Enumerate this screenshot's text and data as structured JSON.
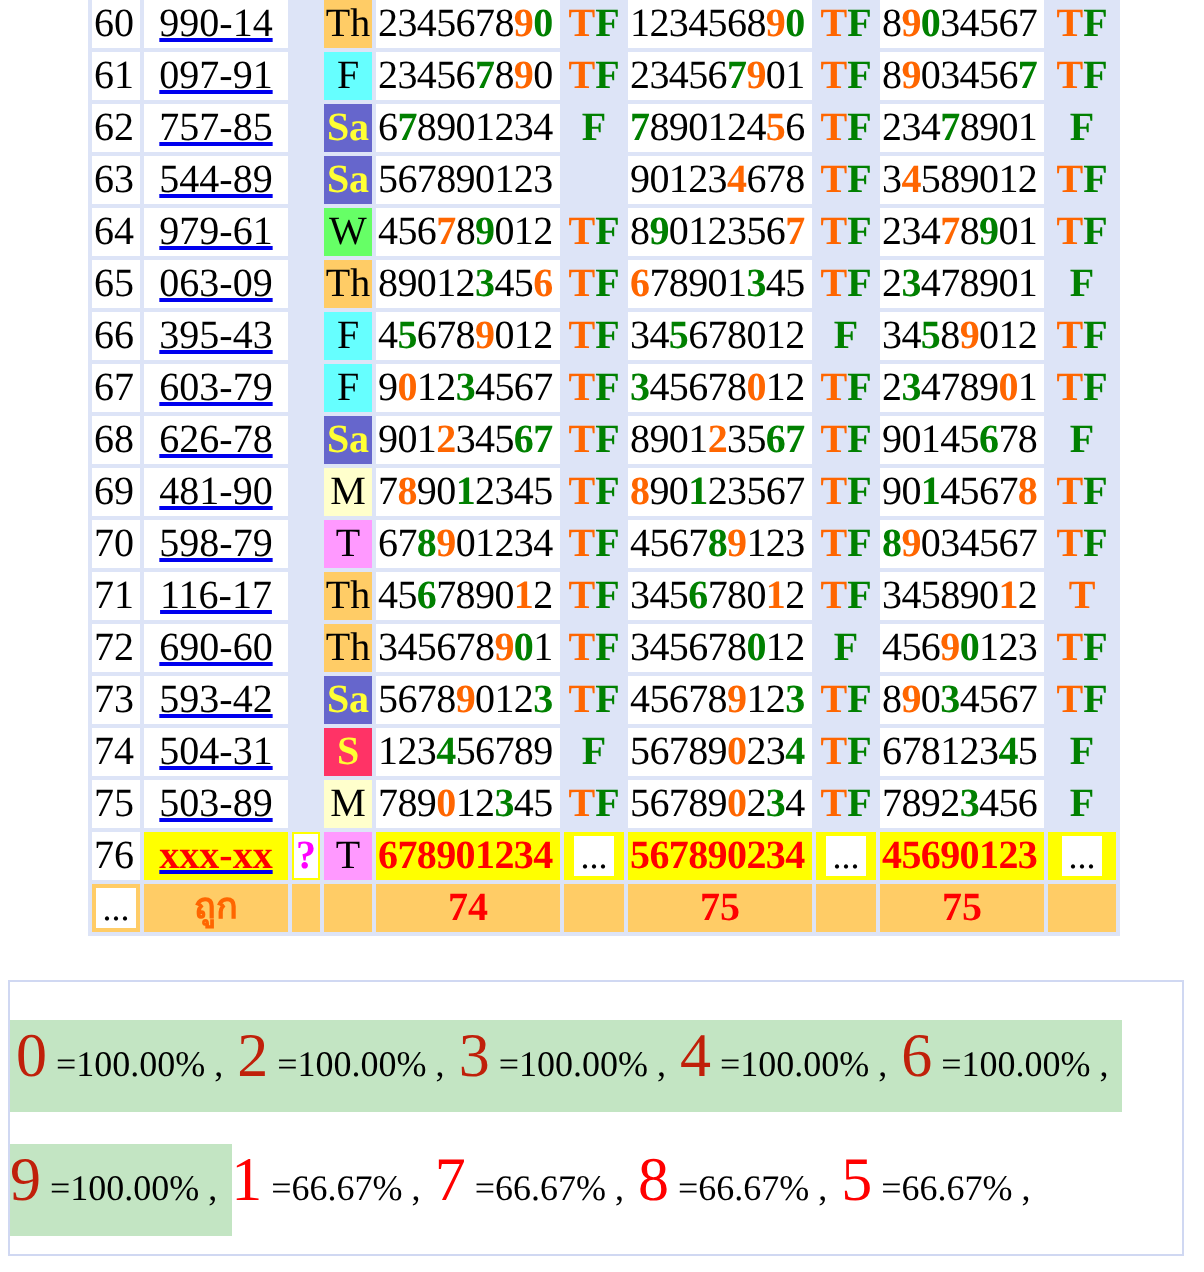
{
  "rows": [
    {
      "index": "60",
      "code": "990-14",
      "day": {
        "text": "Th",
        "color": "#ffcc66"
      },
      "numbers": [
        {
          "digits": [
            {
              "text": "2345678"
            },
            {
              "text": "9",
              "color": "#ff6600"
            },
            {
              "text": "0",
              "color": "#008000"
            }
          ],
          "result": [
            {
              "text": "T",
              "color": "#ff6600"
            },
            {
              "text": "F",
              "color": "#008000"
            }
          ]
        },
        {
          "digits": [
            {
              "text": "1234568"
            },
            {
              "text": "9",
              "color": "#ff6600"
            },
            {
              "text": "0",
              "color": "#008000"
            }
          ],
          "result": [
            {
              "text": "T",
              "color": "#ff6600"
            },
            {
              "text": "F",
              "color": "#008000"
            }
          ]
        },
        {
          "digits": [
            {
              "text": "8"
            },
            {
              "text": "9",
              "color": "#ff6600"
            },
            {
              "text": "0",
              "color": "#008000"
            },
            {
              "text": "34567"
            }
          ],
          "result": [
            {
              "text": "T",
              "color": "#ff6600"
            },
            {
              "text": "F",
              "color": "#008000"
            }
          ]
        }
      ]
    },
    {
      "index": "61",
      "code": "097-91",
      "day": {
        "text": "F",
        "color": "#66ffff"
      },
      "numbers": [
        {
          "digits": [
            {
              "text": "23456"
            },
            {
              "text": "7",
              "color": "#008000"
            },
            {
              "text": "8"
            },
            {
              "text": "9",
              "color": "#ff6600"
            },
            {
              "text": "0"
            }
          ],
          "result": [
            {
              "text": "T",
              "color": "#ff6600"
            },
            {
              "text": "F",
              "color": "#008000"
            }
          ]
        },
        {
          "digits": [
            {
              "text": "23456"
            },
            {
              "text": "7",
              "color": "#008000"
            },
            {
              "text": "9",
              "color": "#ff6600"
            },
            {
              "text": "01"
            }
          ],
          "result": [
            {
              "text": "T",
              "color": "#ff6600"
            },
            {
              "text": "F",
              "color": "#008000"
            }
          ]
        },
        {
          "digits": [
            {
              "text": "8"
            },
            {
              "text": "9",
              "color": "#ff6600"
            },
            {
              "text": "03456"
            },
            {
              "text": "7",
              "color": "#008000"
            }
          ],
          "result": [
            {
              "text": "T",
              "color": "#ff6600"
            },
            {
              "text": "F",
              "color": "#008000"
            }
          ]
        }
      ]
    },
    {
      "index": "62",
      "code": "757-85",
      "day": {
        "text": "Sa",
        "color": "#6666cc"
      },
      "numbers": [
        {
          "digits": [
            {
              "text": "6"
            },
            {
              "text": "7",
              "color": "#008000"
            },
            {
              "text": "8901234"
            }
          ],
          "result": [
            {
              "text": "F",
              "color": "#008000"
            }
          ]
        },
        {
          "digits": [
            {
              "text": "7",
              "color": "#008000"
            },
            {
              "text": "890124"
            },
            {
              "text": "5",
              "color": "#ff6600"
            },
            {
              "text": "6"
            }
          ],
          "result": [
            {
              "text": "T",
              "color": "#ff6600"
            },
            {
              "text": "F",
              "color": "#008000"
            }
          ]
        },
        {
          "digits": [
            {
              "text": "234"
            },
            {
              "text": "7",
              "color": "#008000"
            },
            {
              "text": "8901"
            }
          ],
          "result": [
            {
              "text": "F",
              "color": "#008000"
            }
          ]
        }
      ]
    },
    {
      "index": "63",
      "code": "544-89",
      "day": {
        "text": "Sa",
        "color": "#6666cc"
      },
      "numbers": [
        {
          "digits": [
            {
              "text": "567890123"
            }
          ]
        },
        {
          "digits": [
            {
              "text": "90123"
            },
            {
              "text": "4",
              "color": "#ff6600"
            },
            {
              "text": "678"
            }
          ],
          "result": [
            {
              "text": "T",
              "color": "#ff6600"
            },
            {
              "text": "F",
              "color": "#008000"
            }
          ]
        },
        {
          "digits": [
            {
              "text": "3"
            },
            {
              "text": "4",
              "color": "#ff6600"
            },
            {
              "text": "589012"
            }
          ],
          "result": [
            {
              "text": "T",
              "color": "#ff6600"
            },
            {
              "text": "F",
              "color": "#008000"
            }
          ]
        }
      ]
    },
    {
      "index": "64",
      "code": "979-61",
      "day": {
        "text": "W",
        "color": "#66ff66"
      },
      "numbers": [
        {
          "digits": [
            {
              "text": "456"
            },
            {
              "text": "7",
              "color": "#ff6600"
            },
            {
              "text": "8"
            },
            {
              "text": "9",
              "color": "#008000"
            },
            {
              "text": "012"
            }
          ],
          "result": [
            {
              "text": "T",
              "color": "#ff6600"
            },
            {
              "text": "F",
              "color": "#008000"
            }
          ]
        },
        {
          "digits": [
            {
              "text": "8"
            },
            {
              "text": "9",
              "color": "#008000"
            },
            {
              "text": "012356"
            },
            {
              "text": "7",
              "color": "#ff6600"
            }
          ],
          "result": [
            {
              "text": "T",
              "color": "#ff6600"
            },
            {
              "text": "F",
              "color": "#008000"
            }
          ]
        },
        {
          "digits": [
            {
              "text": "234"
            },
            {
              "text": "7",
              "color": "#ff6600"
            },
            {
              "text": "8"
            },
            {
              "text": "9",
              "color": "#008000"
            },
            {
              "text": "01"
            }
          ],
          "result": [
            {
              "text": "T",
              "color": "#ff6600"
            },
            {
              "text": "F",
              "color": "#008000"
            }
          ]
        }
      ]
    },
    {
      "index": "65",
      "code": "063-09",
      "day": {
        "text": "Th",
        "color": "#ffcc66"
      },
      "numbers": [
        {
          "digits": [
            {
              "text": "89012"
            },
            {
              "text": "3",
              "color": "#008000"
            },
            {
              "text": "45"
            },
            {
              "text": "6",
              "color": "#ff6600"
            }
          ],
          "result": [
            {
              "text": "T",
              "color": "#ff6600"
            },
            {
              "text": "F",
              "color": "#008000"
            }
          ]
        },
        {
          "digits": [
            {
              "text": "6",
              "color": "#ff6600"
            },
            {
              "text": "78901"
            },
            {
              "text": "3",
              "color": "#008000"
            },
            {
              "text": "45"
            }
          ],
          "result": [
            {
              "text": "T",
              "color": "#ff6600"
            },
            {
              "text": "F",
              "color": "#008000"
            }
          ]
        },
        {
          "digits": [
            {
              "text": "2"
            },
            {
              "text": "3",
              "color": "#008000"
            },
            {
              "text": "478901"
            }
          ],
          "result": [
            {
              "text": "F",
              "color": "#008000"
            }
          ]
        }
      ]
    },
    {
      "index": "66",
      "code": "395-43",
      "day": {
        "text": "F",
        "color": "#66ffff"
      },
      "numbers": [
        {
          "digits": [
            {
              "text": "4"
            },
            {
              "text": "5",
              "color": "#008000"
            },
            {
              "text": "678"
            },
            {
              "text": "9",
              "color": "#ff6600"
            },
            {
              "text": "012"
            }
          ],
          "result": [
            {
              "text": "T",
              "color": "#ff6600"
            },
            {
              "text": "F",
              "color": "#008000"
            }
          ]
        },
        {
          "digits": [
            {
              "text": "34"
            },
            {
              "text": "5",
              "color": "#008000"
            },
            {
              "text": "678012"
            }
          ],
          "result": [
            {
              "text": "F",
              "color": "#008000"
            }
          ]
        },
        {
          "digits": [
            {
              "text": "34"
            },
            {
              "text": "5",
              "color": "#008000"
            },
            {
              "text": "8"
            },
            {
              "text": "9",
              "color": "#ff6600"
            },
            {
              "text": "012"
            }
          ],
          "result": [
            {
              "text": "T",
              "color": "#ff6600"
            },
            {
              "text": "F",
              "color": "#008000"
            }
          ]
        }
      ]
    },
    {
      "index": "67",
      "code": "603-79",
      "day": {
        "text": "F",
        "color": "#66ffff"
      },
      "numbers": [
        {
          "digits": [
            {
              "text": "9"
            },
            {
              "text": "0",
              "color": "#ff6600"
            },
            {
              "text": "12"
            },
            {
              "text": "3",
              "color": "#008000"
            },
            {
              "text": "4567"
            }
          ],
          "result": [
            {
              "text": "T",
              "color": "#ff6600"
            },
            {
              "text": "F",
              "color": "#008000"
            }
          ]
        },
        {
          "digits": [
            {
              "text": "3",
              "color": "#008000"
            },
            {
              "text": "45678"
            },
            {
              "text": "0",
              "color": "#ff6600"
            },
            {
              "text": "12"
            }
          ],
          "result": [
            {
              "text": "T",
              "color": "#ff6600"
            },
            {
              "text": "F",
              "color": "#008000"
            }
          ]
        },
        {
          "digits": [
            {
              "text": "2"
            },
            {
              "text": "3",
              "color": "#008000"
            },
            {
              "text": "4789"
            },
            {
              "text": "0",
              "color": "#ff6600"
            },
            {
              "text": "1"
            }
          ],
          "result": [
            {
              "text": "T",
              "color": "#ff6600"
            },
            {
              "text": "F",
              "color": "#008000"
            }
          ]
        }
      ]
    },
    {
      "index": "68",
      "code": "626-78",
      "day": {
        "text": "Sa",
        "color": "#6666cc"
      },
      "numbers": [
        {
          "digits": [
            {
              "text": "901"
            },
            {
              "text": "2",
              "color": "#ff6600"
            },
            {
              "text": "345"
            },
            {
              "text": "67",
              "color": "#008000"
            }
          ],
          "result": [
            {
              "text": "T",
              "color": "#ff6600"
            },
            {
              "text": "F",
              "color": "#008000"
            }
          ]
        },
        {
          "digits": [
            {
              "text": "8901"
            },
            {
              "text": "2",
              "color": "#ff6600"
            },
            {
              "text": "35"
            },
            {
              "text": "67",
              "color": "#008000"
            }
          ],
          "result": [
            {
              "text": "T",
              "color": "#ff6600"
            },
            {
              "text": "F",
              "color": "#008000"
            }
          ]
        },
        {
          "digits": [
            {
              "text": "90145"
            },
            {
              "text": "6",
              "color": "#008000"
            },
            {
              "text": "78"
            }
          ],
          "result": [
            {
              "text": "F",
              "color": "#008000"
            }
          ]
        }
      ]
    },
    {
      "index": "69",
      "code": "481-90",
      "day": {
        "text": "M",
        "color": "#ffffcc"
      },
      "numbers": [
        {
          "digits": [
            {
              "text": "7"
            },
            {
              "text": "8",
              "color": "#ff6600"
            },
            {
              "text": "90"
            },
            {
              "text": "1",
              "color": "#008000"
            },
            {
              "text": "2345"
            }
          ],
          "result": [
            {
              "text": "T",
              "color": "#ff6600"
            },
            {
              "text": "F",
              "color": "#008000"
            }
          ]
        },
        {
          "digits": [
            {
              "text": "8",
              "color": "#ff6600"
            },
            {
              "text": "90"
            },
            {
              "text": "1",
              "color": "#008000"
            },
            {
              "text": "23567"
            }
          ],
          "result": [
            {
              "text": "T",
              "color": "#ff6600"
            },
            {
              "text": "F",
              "color": "#008000"
            }
          ]
        },
        {
          "digits": [
            {
              "text": "90"
            },
            {
              "text": "1",
              "color": "#008000"
            },
            {
              "text": "4567"
            },
            {
              "text": "8",
              "color": "#ff6600"
            }
          ],
          "result": [
            {
              "text": "T",
              "color": "#ff6600"
            },
            {
              "text": "F",
              "color": "#008000"
            }
          ]
        }
      ]
    },
    {
      "index": "70",
      "code": "598-79",
      "day": {
        "text": "T",
        "color": "#ff99ff"
      },
      "numbers": [
        {
          "digits": [
            {
              "text": "67"
            },
            {
              "text": "8",
              "color": "#008000"
            },
            {
              "text": "9",
              "color": "#ff6600"
            },
            {
              "text": "01234"
            }
          ],
          "result": [
            {
              "text": "T",
              "color": "#ff6600"
            },
            {
              "text": "F",
              "color": "#008000"
            }
          ]
        },
        {
          "digits": [
            {
              "text": "4567"
            },
            {
              "text": "8",
              "color": "#008000"
            },
            {
              "text": "9",
              "color": "#ff6600"
            },
            {
              "text": "123"
            }
          ],
          "result": [
            {
              "text": "T",
              "color": "#ff6600"
            },
            {
              "text": "F",
              "color": "#008000"
            }
          ]
        },
        {
          "digits": [
            {
              "text": "8",
              "color": "#008000"
            },
            {
              "text": "9",
              "color": "#ff6600"
            },
            {
              "text": "034567"
            }
          ],
          "result": [
            {
              "text": "T",
              "color": "#ff6600"
            },
            {
              "text": "F",
              "color": "#008000"
            }
          ]
        }
      ]
    },
    {
      "index": "71",
      "code": "116-17",
      "day": {
        "text": "Th",
        "color": "#ffcc66"
      },
      "numbers": [
        {
          "digits": [
            {
              "text": "45"
            },
            {
              "text": "6",
              "color": "#008000"
            },
            {
              "text": "7890"
            },
            {
              "text": "1",
              "color": "#ff6600"
            },
            {
              "text": "2"
            }
          ],
          "result": [
            {
              "text": "T",
              "color": "#ff6600"
            },
            {
              "text": "F",
              "color": "#008000"
            }
          ]
        },
        {
          "digits": [
            {
              "text": "345"
            },
            {
              "text": "6",
              "color": "#008000"
            },
            {
              "text": "780"
            },
            {
              "text": "1",
              "color": "#ff6600"
            },
            {
              "text": "2"
            }
          ],
          "result": [
            {
              "text": "T",
              "color": "#ff6600"
            },
            {
              "text": "F",
              "color": "#008000"
            }
          ]
        },
        {
          "digits": [
            {
              "text": "345890"
            },
            {
              "text": "1",
              "color": "#ff6600"
            },
            {
              "text": "2"
            }
          ],
          "result": [
            {
              "text": "T",
              "color": "#ff6600"
            }
          ]
        }
      ]
    },
    {
      "index": "72",
      "code": "690-60",
      "day": {
        "text": "Th",
        "color": "#ffcc66"
      },
      "numbers": [
        {
          "digits": [
            {
              "text": "345678"
            },
            {
              "text": "9",
              "color": "#ff6600"
            },
            {
              "text": "0",
              "color": "#008000"
            },
            {
              "text": "1"
            }
          ],
          "result": [
            {
              "text": "T",
              "color": "#ff6600"
            },
            {
              "text": "F",
              "color": "#008000"
            }
          ]
        },
        {
          "digits": [
            {
              "text": "345678"
            },
            {
              "text": "0",
              "color": "#008000"
            },
            {
              "text": "12"
            }
          ],
          "result": [
            {
              "text": "F",
              "color": "#008000"
            }
          ]
        },
        {
          "digits": [
            {
              "text": "456"
            },
            {
              "text": "9",
              "color": "#ff6600"
            },
            {
              "text": "0",
              "color": "#008000"
            },
            {
              "text": "123"
            }
          ],
          "result": [
            {
              "text": "T",
              "color": "#ff6600"
            },
            {
              "text": "F",
              "color": "#008000"
            }
          ]
        }
      ]
    },
    {
      "index": "73",
      "code": "593-42",
      "day": {
        "text": "Sa",
        "color": "#6666cc"
      },
      "numbers": [
        {
          "digits": [
            {
              "text": "5678"
            },
            {
              "text": "9",
              "color": "#ff6600"
            },
            {
              "text": "012"
            },
            {
              "text": "3",
              "color": "#008000"
            }
          ],
          "result": [
            {
              "text": "T",
              "color": "#ff6600"
            },
            {
              "text": "F",
              "color": "#008000"
            }
          ]
        },
        {
          "digits": [
            {
              "text": "45678"
            },
            {
              "text": "9",
              "color": "#ff6600"
            },
            {
              "text": "12"
            },
            {
              "text": "3",
              "color": "#008000"
            }
          ],
          "result": [
            {
              "text": "T",
              "color": "#ff6600"
            },
            {
              "text": "F",
              "color": "#008000"
            }
          ]
        },
        {
          "digits": [
            {
              "text": "8"
            },
            {
              "text": "9",
              "color": "#ff6600"
            },
            {
              "text": "0"
            },
            {
              "text": "3",
              "color": "#008000"
            },
            {
              "text": "4567"
            }
          ],
          "result": [
            {
              "text": "T",
              "color": "#ff6600"
            },
            {
              "text": "F",
              "color": "#008000"
            }
          ]
        }
      ]
    },
    {
      "index": "74",
      "code": "504-31",
      "day": {
        "text": "S",
        "color": "#ff3366"
      },
      "numbers": [
        {
          "digits": [
            {
              "text": "123"
            },
            {
              "text": "4",
              "color": "#008000"
            },
            {
              "text": "56789"
            }
          ],
          "result": [
            {
              "text": "F",
              "color": "#008000"
            }
          ]
        },
        {
          "digits": [
            {
              "text": "56789"
            },
            {
              "text": "0",
              "color": "#ff6600"
            },
            {
              "text": "23"
            },
            {
              "text": "4",
              "color": "#008000"
            }
          ],
          "result": [
            {
              "text": "T",
              "color": "#ff6600"
            },
            {
              "text": "F",
              "color": "#008000"
            }
          ]
        },
        {
          "digits": [
            {
              "text": "678123"
            },
            {
              "text": "4",
              "color": "#008000"
            },
            {
              "text": "5"
            }
          ],
          "result": [
            {
              "text": "F",
              "color": "#008000"
            }
          ]
        }
      ]
    },
    {
      "index": "75",
      "code": "503-89",
      "day": {
        "text": "M",
        "color": "#ffffcc"
      },
      "numbers": [
        {
          "digits": [
            {
              "text": "789"
            },
            {
              "text": "0",
              "color": "#ff6600"
            },
            {
              "text": "12"
            },
            {
              "text": "3",
              "color": "#008000"
            },
            {
              "text": "45"
            }
          ],
          "result": [
            {
              "text": "T",
              "color": "#ff6600"
            },
            {
              "text": "F",
              "color": "#008000"
            }
          ]
        },
        {
          "digits": [
            {
              "text": "56789"
            },
            {
              "text": "0",
              "color": "#ff6600"
            },
            {
              "text": "2"
            },
            {
              "text": "3",
              "color": "#008000"
            },
            {
              "text": "4"
            }
          ],
          "result": [
            {
              "text": "T",
              "color": "#ff6600"
            },
            {
              "text": "F",
              "color": "#008000"
            }
          ]
        },
        {
          "digits": [
            {
              "text": "7892"
            },
            {
              "text": "3",
              "color": "#008000"
            },
            {
              "text": "456"
            }
          ],
          "result": [
            {
              "text": "F",
              "color": "#008000"
            }
          ]
        }
      ]
    }
  ],
  "current_row": {
    "index": "76",
    "code": "xxx-xx",
    "flag": "?",
    "day": {
      "text": "T",
      "color": "#ff99ff"
    },
    "numbers": [
      {
        "value": "678901234",
        "more": "..."
      },
      {
        "value": "567890234",
        "more": "..."
      },
      {
        "value": "45690123",
        "more": "..."
      }
    ]
  },
  "totals": {
    "more": "...",
    "label": "ถูก",
    "counts": [
      "74",
      "75",
      "75"
    ]
  },
  "digit_stats": [
    {
      "digit": "0",
      "percent": "=100.00%",
      "separator": ",",
      "highlighted": true
    },
    {
      "digit": "2",
      "percent": "=100.00%",
      "separator": ",",
      "highlighted": true
    },
    {
      "digit": "3",
      "percent": "=100.00%",
      "separator": ",",
      "highlighted": true
    },
    {
      "digit": "4",
      "percent": "=100.00%",
      "separator": ",",
      "highlighted": true
    },
    {
      "digit": "6",
      "percent": "=100.00%",
      "separator": ",",
      "highlighted": true
    },
    {
      "digit": "9",
      "percent": "=100.00%",
      "separator": ",",
      "highlighted": true
    },
    {
      "digit": "1",
      "percent": "=66.67%",
      "separator": ",",
      "highlighted": false
    },
    {
      "digit": "7",
      "percent": "=66.67%",
      "separator": ",",
      "highlighted": false
    },
    {
      "digit": "8",
      "percent": "=66.67%",
      "separator": ",",
      "highlighted": false
    },
    {
      "digit": "5",
      "percent": "=66.67%",
      "separator": ",",
      "highlighted": false
    }
  ]
}
